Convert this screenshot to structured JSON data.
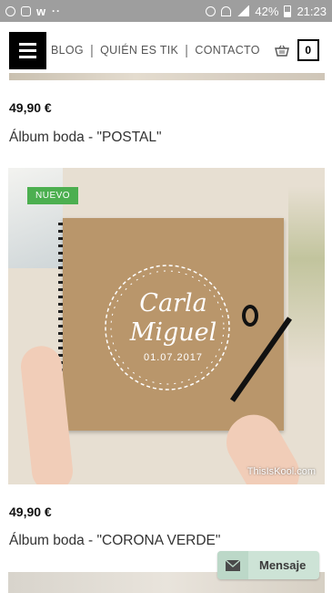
{
  "status_bar": {
    "battery": "42%",
    "time": "21:23"
  },
  "header": {
    "nav": [
      "BLOG",
      "QUIÉN ES TIK",
      "CONTACTO"
    ],
    "cart_count": "0"
  },
  "products": [
    {
      "price": "49,90 €",
      "title": "Álbum boda - \"POSTAL\""
    },
    {
      "badge": "NUEVO",
      "image_text": {
        "name1": "Carla",
        "name2": "Miguel",
        "date": "01.07.2017",
        "watermark": "ThisIsKool.com"
      },
      "price": "49,90 €",
      "title": "Álbum boda - \"CORONA VERDE\""
    }
  ],
  "message_button": {
    "label": "Mensaje"
  },
  "colors": {
    "badge": "#4caf50",
    "message_button": "#cde3d6",
    "status_bar": "#9e9e9e"
  }
}
